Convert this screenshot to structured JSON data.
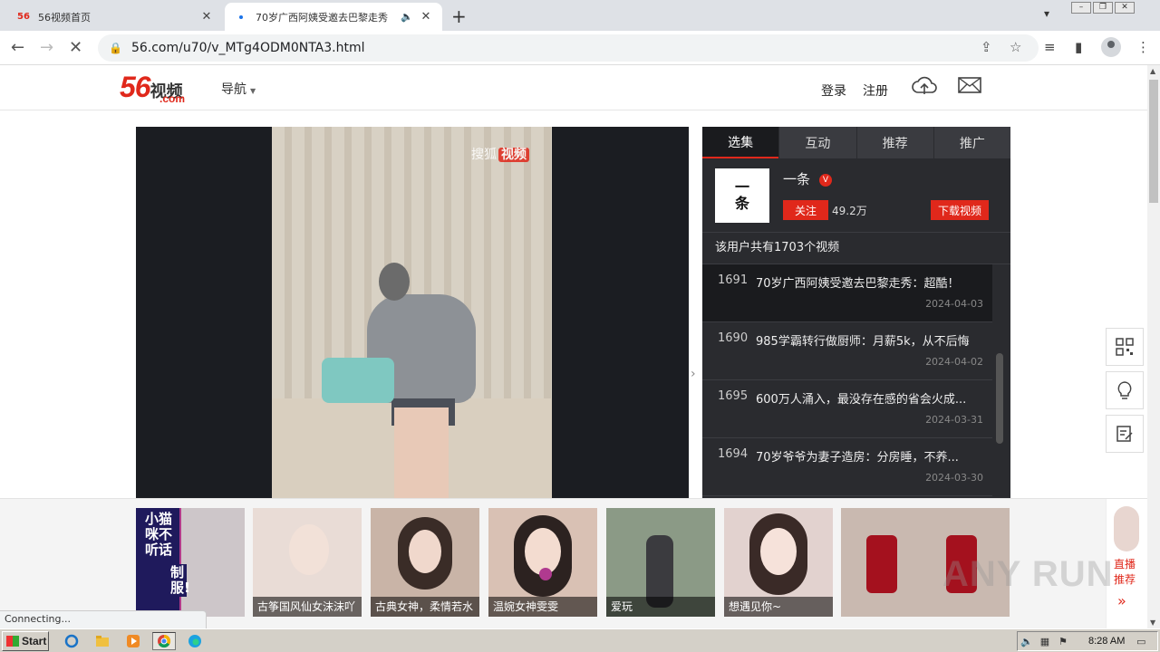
{
  "browser": {
    "tabs": [
      {
        "title": "56视频首页",
        "favicon": "56",
        "active": false
      },
      {
        "title": "70岁广西阿姨受邀去巴黎走秀",
        "favicon": "loading",
        "active": true
      }
    ],
    "new_tab": "+",
    "url": "56.com/u70/v_MTg4ODM0NTA3.html",
    "status_text": "Connecting..."
  },
  "site": {
    "logo_num": "56",
    "logo_cn": "视频",
    "logo_com": ".com",
    "nav_label": "导航",
    "login": "登录",
    "register": "注册"
  },
  "player": {
    "watermark_prefix": "搜狐",
    "watermark_badge": "视频"
  },
  "panel": {
    "tabs": [
      "选集",
      "互动",
      "推荐",
      "推广"
    ],
    "uploader": {
      "avatar_line1": "一",
      "avatar_line2": "条",
      "name": "一条",
      "verified_badge": "V",
      "follow_label": "关注",
      "fans": "49.2万",
      "download_label": "下载视频"
    },
    "total_text": "该用户共有1703个视频",
    "videos": [
      {
        "num": "1691",
        "title": "70岁广西阿姨受邀去巴黎走秀：超酷！",
        "date": "2024-04-03",
        "current": true
      },
      {
        "num": "1690",
        "title": "985学霸转行做厨师：月薪5k，从不后悔",
        "date": "2024-04-02",
        "current": false
      },
      {
        "num": "1695",
        "title": "600万人涌入，最没存在感的省会火成...",
        "date": "2024-03-31",
        "current": false
      },
      {
        "num": "1694",
        "title": "70岁爷爷为妻子造房：分房睡，不养...",
        "date": "2024-03-30",
        "current": false
      }
    ]
  },
  "livebar": {
    "cards": [
      {
        "caption": "",
        "bg": "#b23a8a"
      },
      {
        "caption": "古筝国风仙女沫沫吖",
        "bg": "#e9dcd6"
      },
      {
        "caption": "古典女神，柔情若水",
        "bg": "#c9b4a7"
      },
      {
        "caption": "温婉女神雯雯",
        "bg": "#d9c1b4"
      },
      {
        "caption": "爱玩",
        "bg": "#8b9a86"
      },
      {
        "caption": "想遇见你~",
        "bg": "#e2d2cf"
      },
      {
        "caption": "",
        "bg": "#c9b9b0"
      }
    ],
    "side_label_1": "直播",
    "side_label_2": "推荐",
    "side_arrow": "»",
    "promo_vertical_text": "小猫咪不听话",
    "promo_side_text": "制服!"
  },
  "watermark": "ANY RUN",
  "taskbar": {
    "start_label": "Start",
    "clock": "8:28 AM"
  },
  "colors": {
    "brand_red": "#e0281b",
    "panel_bg": "#2a2b2f",
    "player_bg": "#1b1d22"
  }
}
